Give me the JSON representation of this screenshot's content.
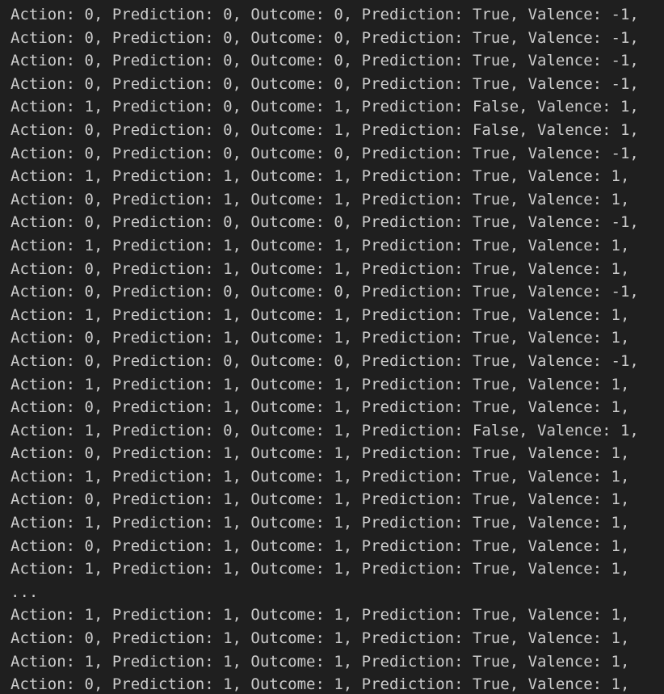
{
  "output": {
    "lines": [
      "Action: 0, Prediction: 0, Outcome: 0, Prediction: True, Valence: -1,",
      "Action: 0, Prediction: 0, Outcome: 0, Prediction: True, Valence: -1,",
      "Action: 0, Prediction: 0, Outcome: 0, Prediction: True, Valence: -1,",
      "Action: 0, Prediction: 0, Outcome: 0, Prediction: True, Valence: -1,",
      "Action: 1, Prediction: 0, Outcome: 1, Prediction: False, Valence: 1,",
      "Action: 0, Prediction: 0, Outcome: 1, Prediction: False, Valence: 1,",
      "Action: 0, Prediction: 0, Outcome: 0, Prediction: True, Valence: -1,",
      "Action: 1, Prediction: 1, Outcome: 1, Prediction: True, Valence: 1,",
      "Action: 0, Prediction: 1, Outcome: 1, Prediction: True, Valence: 1,",
      "Action: 0, Prediction: 0, Outcome: 0, Prediction: True, Valence: -1,",
      "Action: 1, Prediction: 1, Outcome: 1, Prediction: True, Valence: 1,",
      "Action: 0, Prediction: 1, Outcome: 1, Prediction: True, Valence: 1,",
      "Action: 0, Prediction: 0, Outcome: 0, Prediction: True, Valence: -1,",
      "Action: 1, Prediction: 1, Outcome: 1, Prediction: True, Valence: 1,",
      "Action: 0, Prediction: 1, Outcome: 1, Prediction: True, Valence: 1,",
      "Action: 0, Prediction: 0, Outcome: 0, Prediction: True, Valence: -1,",
      "Action: 1, Prediction: 1, Outcome: 1, Prediction: True, Valence: 1,",
      "Action: 0, Prediction: 1, Outcome: 1, Prediction: True, Valence: 1,",
      "Action: 1, Prediction: 0, Outcome: 1, Prediction: False, Valence: 1,",
      "Action: 0, Prediction: 1, Outcome: 1, Prediction: True, Valence: 1,",
      "Action: 1, Prediction: 1, Outcome: 1, Prediction: True, Valence: 1,",
      "Action: 0, Prediction: 1, Outcome: 1, Prediction: True, Valence: 1,",
      "Action: 1, Prediction: 1, Outcome: 1, Prediction: True, Valence: 1,",
      "Action: 0, Prediction: 1, Outcome: 1, Prediction: True, Valence: 1,",
      "Action: 1, Prediction: 1, Outcome: 1, Prediction: True, Valence: 1,",
      "...",
      "Action: 1, Prediction: 1, Outcome: 1, Prediction: True, Valence: 1,",
      "Action: 0, Prediction: 1, Outcome: 1, Prediction: True, Valence: 1,",
      "Action: 1, Prediction: 1, Outcome: 1, Prediction: True, Valence: 1,",
      "Action: 0, Prediction: 1, Outcome: 1, Prediction: True, Valence: 1,"
    ]
  },
  "colors": {
    "background": "#1f1f1f",
    "text": "#cccccc"
  }
}
